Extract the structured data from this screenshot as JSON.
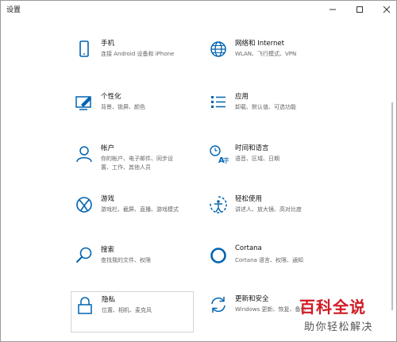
{
  "window": {
    "title": "设置",
    "controls": {
      "minimize": "minimize",
      "maximize": "maximize",
      "close": "close"
    }
  },
  "tiles": [
    {
      "icon": "phone-icon",
      "name": "手机",
      "desc": "连接 Android 设备和 iPhone"
    },
    {
      "icon": "globe-icon",
      "name": "网络和 Internet",
      "desc": "WLAN、飞行模式、VPN"
    },
    {
      "icon": "personalization-icon",
      "name": "个性化",
      "desc": "背景、锁屏、颜色"
    },
    {
      "icon": "apps-icon",
      "name": "应用",
      "desc": "卸载、默认值、可选功能"
    },
    {
      "icon": "person-icon",
      "name": "帐户",
      "desc": "你的帐户、电子邮件、同步设\n置、工作、其他人员"
    },
    {
      "icon": "time-language-icon",
      "name": "时间和语言",
      "desc": "语音、区域、日期"
    },
    {
      "icon": "xbox-icon",
      "name": "游戏",
      "desc": "游戏栏、截屏、直播、游戏模式"
    },
    {
      "icon": "ease-of-access-icon",
      "name": "轻松使用",
      "desc": "讲述人、放大镜、高对比度"
    },
    {
      "icon": "search-icon",
      "name": "搜索",
      "desc": "查找我的文件、权限"
    },
    {
      "icon": "cortana-icon",
      "name": "Cortana",
      "desc": "Cortana 语言、权限、通知"
    },
    {
      "icon": "lock-icon",
      "name": "隐私",
      "desc": "位置、相机、麦克风"
    },
    {
      "icon": "update-icon",
      "name": "更新和安全",
      "desc": "Windows 更新、恢复、备份"
    }
  ],
  "watermark": {
    "main": "百科全说",
    "sub": "助你轻松解决"
  },
  "colors": {
    "accent": "#0063b1",
    "watermark_red": "#d01b25"
  }
}
